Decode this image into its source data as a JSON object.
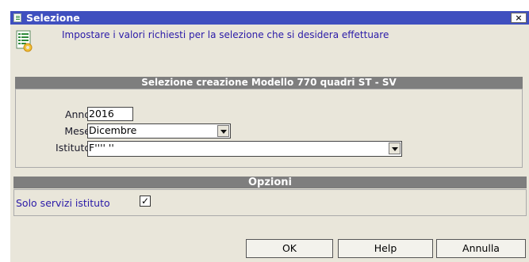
{
  "window": {
    "title": "Selezione",
    "close_glyph": "×"
  },
  "info": {
    "icon": "form-settings-icon",
    "text": "Impostare i valori richiesti per la selezione che si desidera effettuare"
  },
  "section1": {
    "title": "Selezione creazione Modello 770 quadri ST - SV",
    "anno": {
      "label": "Anno",
      "value": "2016"
    },
    "mese": {
      "label": "Mese",
      "value": "Dicembre"
    },
    "istituto": {
      "label": "Istituto",
      "value": "F''''  ''"
    }
  },
  "section2": {
    "title": "Opzioni",
    "solo_servizi": {
      "label": "Solo servizi istituto",
      "checked": true,
      "glyph": "✓"
    }
  },
  "buttons": {
    "ok": "OK",
    "help": "Help",
    "annulla": "Annulla"
  }
}
